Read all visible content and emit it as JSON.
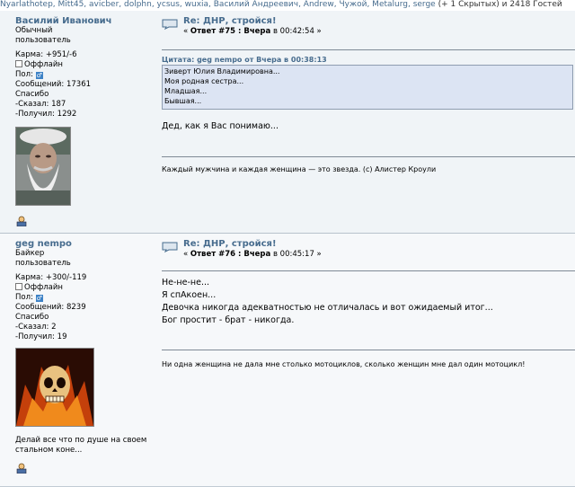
{
  "online_bar": {
    "names": "Nyarlathotep, Mitt45, avicber, dolphn, ycsus, wuxia, Василий Андреевич, Andrew, Чужой, Metalurg, serge",
    "tail": " (+ 1 Скрытых) и 2418 Гостей"
  },
  "posts": [
    {
      "author": {
        "name": "Василий Иванович",
        "rank_line1": "Обычный",
        "rank_line2": "пользователь",
        "karma": "Карма: +951/-6",
        "status": "Оффлайн",
        "gender_label": "Пол:",
        "messages": "Сообщений: 17361",
        "thanks": "Спасибо",
        "said": "-Сказал: 187",
        "got": "-Получил: 1292"
      },
      "subject": "Re: ДНР, стройся!",
      "meta_prefix": "« ",
      "reply_label": "Ответ #75 : Вчера",
      "meta_suffix": " в 00:42:54 »",
      "quote": {
        "header": "Цитата: geg nempo от Вчера в 00:38:13",
        "lines": [
          "Зиверт Юлия Владимировна...",
          "Моя родная сестра...",
          "Младшая...",
          "Бывшая..."
        ]
      },
      "body": [
        "Дед, как я Вас понимаю..."
      ],
      "signature": "Каждый мужчина и каждая женщина — это звезда. (с) Алистер Кроули"
    },
    {
      "author": {
        "name": "geg nempo",
        "rank_line1": "Байкер",
        "rank_line2": "пользователь",
        "karma": "Карма: +300/-119",
        "status": "Оффлайн",
        "gender_label": "Пол:",
        "messages": "Сообщений: 8239",
        "thanks": "Спасибо",
        "said": "-Сказал: 2",
        "got": "-Получил: 19",
        "about_line1": "Делай все что по душе на своем",
        "about_line2": "стальном коне..."
      },
      "subject": "Re: ДНР, стройся!",
      "meta_prefix": "« ",
      "reply_label": "Ответ #76 : Вчера",
      "meta_suffix": " в 00:45:17 »",
      "body": [
        "Не-не-не...",
        "Я спАкоен...",
        "Девочка никогда адекватностью не отличалась и вот ожидаемый итог...",
        "Бог простит - брат - никогда."
      ],
      "signature": "Ни одна женщина не дала мне столько мотоциклов, сколько женщин мне дал один мотоцикл!"
    }
  ],
  "icons": {
    "topic": "topic-icon",
    "gender": "male-icon",
    "profile": "profile-icon",
    "status_box": "offline-checkbox-icon"
  },
  "colors": {
    "link": "#476c8e",
    "quote_bg": "#dce4f3",
    "gender": "#3d82c6"
  }
}
